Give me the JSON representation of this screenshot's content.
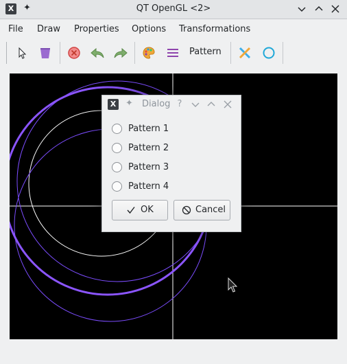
{
  "window": {
    "title": "QT OpenGL <2>"
  },
  "menu": {
    "items": [
      "File",
      "Draw",
      "Properties",
      "Options",
      "Transformations"
    ]
  },
  "toolbar": {
    "pattern_label": "Pattern",
    "icons": [
      "select-arrow",
      "trash",
      "stop",
      "undo",
      "redo",
      "palette",
      "line-width",
      "cross",
      "circle"
    ]
  },
  "dialog": {
    "title": "Dialog",
    "options": [
      "Pattern 1",
      "Pattern 2",
      "Pattern 3",
      "Pattern 4"
    ],
    "ok_label": "OK",
    "cancel_label": "Cancel"
  },
  "colors": {
    "canvas_bg": "#000000",
    "axis": "#ffffff",
    "circle_white": "#ffffff",
    "circle_purple": "#7c4dff",
    "accent": "#3daee9"
  }
}
